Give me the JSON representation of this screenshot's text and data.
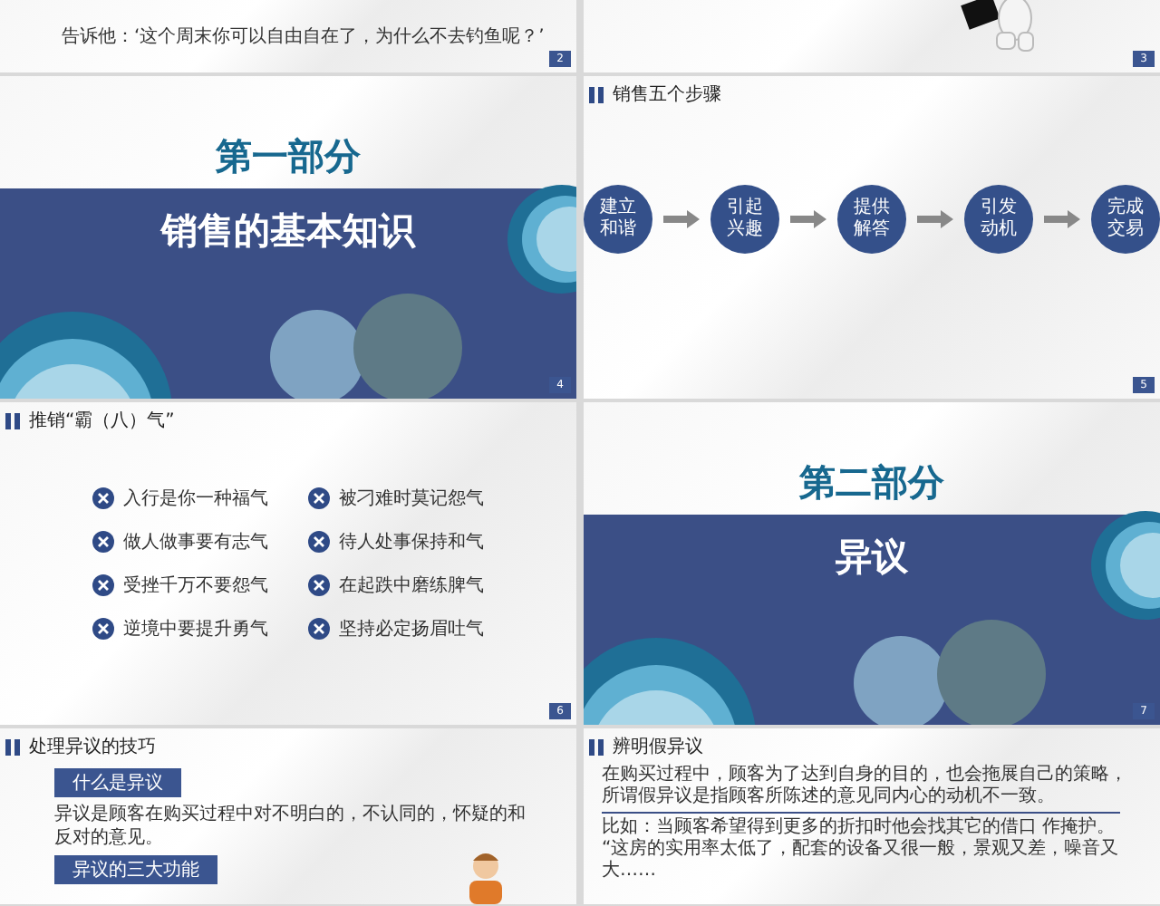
{
  "slides": [
    {
      "kind": "text",
      "page": "2",
      "lines": [
        "告诉他：‘这个周末你可以自由自在了，为什么不去钓鱼呢？’"
      ]
    },
    {
      "kind": "figure",
      "page": "3"
    },
    {
      "kind": "section",
      "part": "第一部分",
      "title": "销售的基本知识",
      "page": "4"
    },
    {
      "kind": "steps",
      "title": "销售五个步骤",
      "steps": [
        "建立和谐",
        "引起兴趣",
        "提供解答",
        "引发动机",
        "完成交易"
      ],
      "page": "5"
    },
    {
      "kind": "list",
      "title": "推销“霸（八）气”",
      "items": [
        "入行是你一种福气",
        "做人做事要有志气",
        "受挫千万不要怨气",
        "逆境中要提升勇气",
        "被刁难时莫记怨气",
        "待人处事保持和气",
        "在起跌中磨练脾气",
        "坚持必定扬眉吐气"
      ],
      "page": "6"
    },
    {
      "kind": "section",
      "part": "第二部分",
      "title": "异议",
      "page": "7"
    },
    {
      "kind": "definition",
      "title": "处理异议的技巧",
      "blocks": [
        {
          "label": "什么是异议",
          "text": "异议是顾客在购买过程中对不明白的，不认同的，怀疑的和反对的意见。"
        },
        {
          "label": "异议的三大功能"
        }
      ]
    },
    {
      "kind": "paragraphs",
      "title": "辨明假异议",
      "intro": [
        "在购买过程中，顾客为了达到自身的目的，也会拖展自己的策略，",
        "所谓假异议是指顾客所陈述的意见同内心的动机不一致。"
      ],
      "example": [
        "比如：当顾客希望得到更多的折扣时他会找其它的借口 作掩护。",
        "“这房的实用率太低了，配套的设备又很一般，景观又差，噪音又大……"
      ]
    }
  ]
}
